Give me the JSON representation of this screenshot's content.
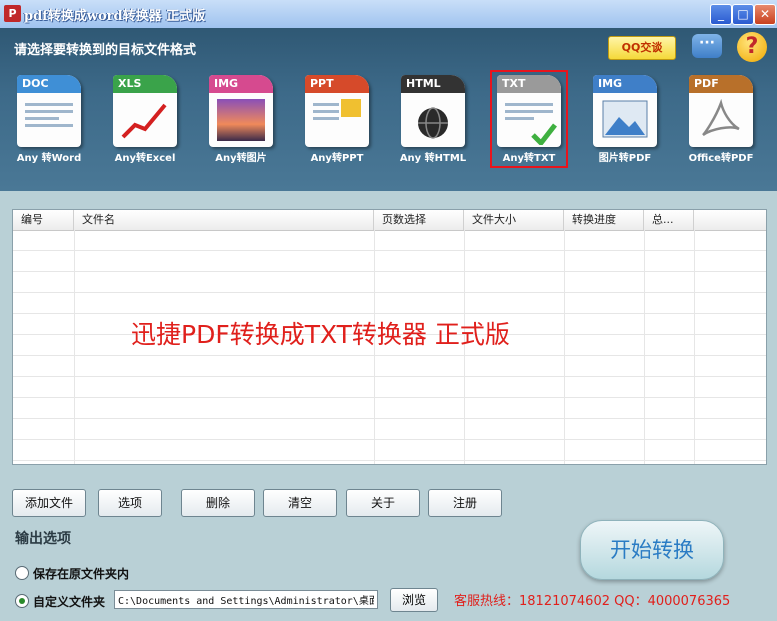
{
  "window": {
    "title": "pdf转换成word转换器  正式版",
    "icon": "app-logo-icon",
    "controls": [
      "minimize",
      "maximize",
      "close"
    ]
  },
  "header": {
    "prompt": "请选择要转换到的目标文件格式",
    "qq_label": "QQ交谈"
  },
  "tools": [
    {
      "badge": "DOC",
      "label": "Any 转Word",
      "color": "#3f8fd6",
      "selected": false
    },
    {
      "badge": "XLS",
      "label": "Any转Excel",
      "color": "#3aa34a",
      "selected": false
    },
    {
      "badge": "IMG",
      "label": "Any转图片",
      "color": "#d64a8f",
      "selected": false
    },
    {
      "badge": "PPT",
      "label": "Any转PPT",
      "color": "#d64a2a",
      "selected": false
    },
    {
      "badge": "HTML",
      "label": "Any 转HTML",
      "color": "#333333",
      "selected": false
    },
    {
      "badge": "TXT",
      "label": "Any转TXT",
      "color": "#9a9a9a",
      "selected": true
    },
    {
      "badge": "IMG",
      "label": "图片转PDF",
      "color": "#3f7fc8",
      "selected": false
    },
    {
      "badge": "PDF",
      "label": "Office转PDF",
      "color": "#b8702a",
      "selected": false
    }
  ],
  "table": {
    "columns": [
      "编号",
      "文件名",
      "页数选择",
      "文件大小",
      "转换进度",
      "总..."
    ],
    "watermark": "迅捷PDF转换成TXT转换器  正式版"
  },
  "buttons": {
    "add": "添加文件",
    "options": "选项",
    "delete": "删除",
    "clear": "清空",
    "about": "关于",
    "register": "注册"
  },
  "output": {
    "title": "输出选项",
    "option_original": "保存在原文件夹内",
    "option_custom": "自定义文件夹",
    "path": "C:\\Documents and Settings\\Administrator\\桌面",
    "browse": "浏览",
    "hotline": "客服热线：18121074602 QQ：4000076365"
  },
  "start_label": "开始转换"
}
